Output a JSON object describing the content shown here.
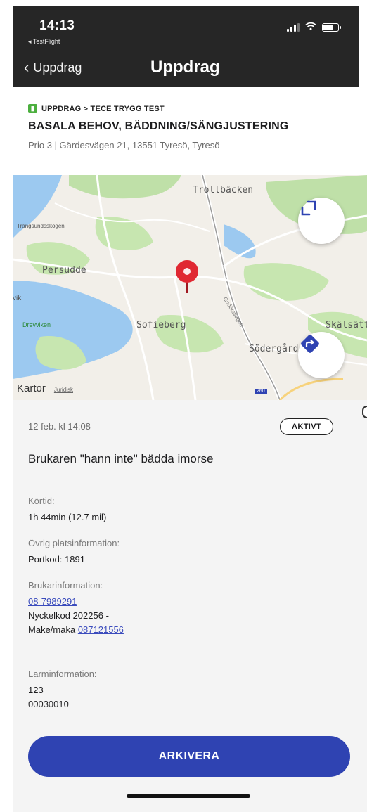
{
  "status_bar": {
    "time": "14:13",
    "back_app": "◂ TestFlight",
    "icons": [
      "signal-icon",
      "wifi-icon",
      "battery-icon"
    ]
  },
  "nav": {
    "back_label": "Uppdrag",
    "title": "Uppdrag"
  },
  "header": {
    "breadcrumb": "UPPDRAG > TECE TRYGG TEST",
    "title": "BASALA BEHOV, BÄDDNING/SÄNGJUSTERING",
    "subtitle": "Prio 3 | Gärdesvägen 21, 13551 Tyresö, Tyresö"
  },
  "map": {
    "labels": {
      "trollbacken": "Trollbäcken",
      "trangsundsskogen": "Trangsundsskogen",
      "persudde": "Persudde",
      "vik": "vik",
      "drevviken": "Drevviken",
      "sofieberg": "Sofieberg",
      "skalsatt": "Skälsätt",
      "sodergard": "Södergård",
      "gudorna": "Gudörsvägen",
      "road_number": "260"
    },
    "attribution": "Kartor",
    "legal": "Juridisk",
    "buttons": [
      "expand-icon",
      "directions-icon"
    ]
  },
  "details": {
    "date": "12 feb. kl 14:08",
    "status": "AKTIVT",
    "description": "Brukaren \"hann inte\" bädda imorse",
    "drive_time_label": "Körtid:",
    "drive_time_value": "1h 44min (12.7 mil)",
    "location_info_label": "Övrig platsinformation:",
    "location_info_value": "Portkod: 1891",
    "user_info_label": "Brukarinformation:",
    "user_phone": "08-7989291",
    "user_key_code": "Nyckelkod 202256 -",
    "spouse_prefix": "Make/maka",
    "spouse_phone": "087121556",
    "alarm_info_label": "Larminformation:",
    "alarm_line1": "123",
    "alarm_line2": "00030010"
  },
  "actions": {
    "archive_label": "ARKIVERA"
  },
  "colors": {
    "primary": "#2f43b2",
    "link": "#3a4bbd",
    "pin": "#e02832",
    "prio_badge": "#4caf3f",
    "top_bar": "#262626"
  }
}
